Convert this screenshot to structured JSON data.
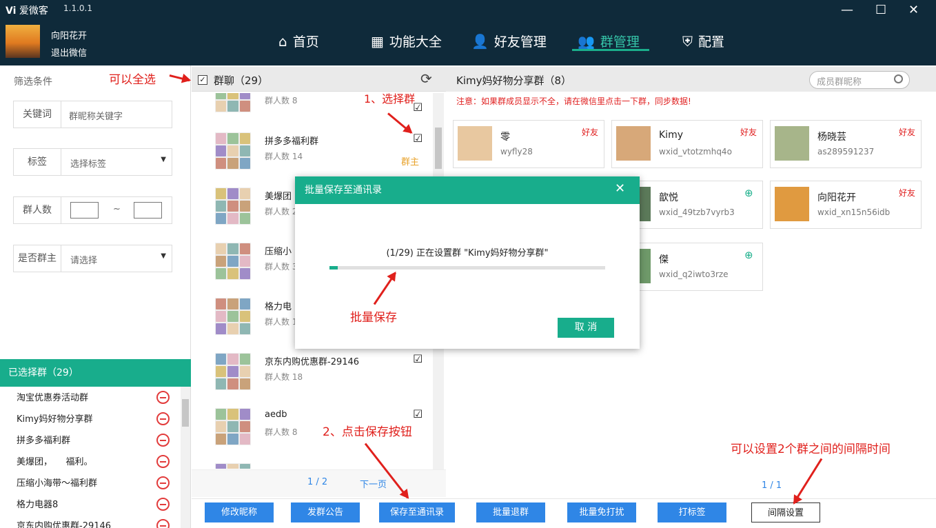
{
  "app": {
    "name": "爱微客",
    "version": "1.1.0.1",
    "logo_mark": "Vi"
  },
  "user": {
    "name": "向阳花开",
    "logout": "退出微信"
  },
  "nav": [
    {
      "label": "首页",
      "icon": "home-icon"
    },
    {
      "label": "功能大全",
      "icon": "grid-icon"
    },
    {
      "label": "好友管理",
      "icon": "user-icon"
    },
    {
      "label": "群管理",
      "icon": "group-icon"
    },
    {
      "label": "配置",
      "icon": "shield-icon"
    }
  ],
  "window": {
    "minimize": "—",
    "maximize": "☐",
    "close": "✕"
  },
  "filter": {
    "title": "筛选条件",
    "keyword_label": "关键词",
    "keyword_placeholder": "群昵称关键字",
    "tag_label": "标签",
    "tag_value": "选择标签",
    "count_label": "群人数",
    "tilde": "~",
    "owner_label": "是否群主",
    "owner_value": "请选择"
  },
  "selected": {
    "title": "已选择群（29）",
    "items": [
      "淘宝优惠券活动群",
      "Kimy妈好物分享群",
      "拼多多福利群",
      "美爆团，　　福利。",
      "压缩小海带～福利群",
      "格力电器8",
      "京东内购优惠群-29146"
    ]
  },
  "groups": {
    "header": "群聊（29）",
    "items": [
      {
        "name": "",
        "count": "群人数 8",
        "owner": "",
        "checked": "☑"
      },
      {
        "name": "拼多多福利群",
        "count": "群人数 14",
        "owner": "群主",
        "checked": "☑"
      },
      {
        "name": "美爆团",
        "count": "群人数 2",
        "owner": "",
        "checked": ""
      },
      {
        "name": "压缩小",
        "count": "群人数 3",
        "owner": "",
        "checked": ""
      },
      {
        "name": "格力电",
        "count": "群人数 1",
        "owner": "",
        "checked": ""
      },
      {
        "name": "京东内购优惠群-29146",
        "count": "群人数 18",
        "owner": "",
        "checked": "☑"
      },
      {
        "name": "aedb",
        "count": "群人数 8",
        "owner": "",
        "checked": "☑"
      },
      {
        "name": "",
        "count": "",
        "owner": "",
        "checked": ""
      }
    ],
    "page": "1 / 2",
    "next": "下一页"
  },
  "members": {
    "title": "Kimy妈好物分享群（8）",
    "search_placeholder": "成员群昵称",
    "note": "注意：如果群成员显示不全，请在微信里点击一下群，同步数据!",
    "page": "1 / 1",
    "cards": [
      {
        "name": "零",
        "id": "wyfly28",
        "badge": "好友"
      },
      {
        "name": "Kimy",
        "id": "wxid_vtotzmhq4o",
        "badge": "好友"
      },
      {
        "name": "杨晓芸",
        "id": "as289591237",
        "badge": "好友"
      },
      {
        "name": "歆悦",
        "id": "wxid_49tzb7vyrb3",
        "badge": ""
      },
      {
        "name": "向阳花开",
        "id": "wxid_xn15n56idb",
        "badge": "好友"
      },
      {
        "name": "傑",
        "id": "wxid_q2iwto3rze",
        "badge": ""
      }
    ]
  },
  "buttons": [
    "修改昵称",
    "发群公告",
    "保存至通讯录",
    "批量退群",
    "批量免打扰",
    "打标签",
    "间隔设置"
  ],
  "modal": {
    "title": "批量保存至通讯录",
    "message": "(1/29) 正在设置群 \"Kimy妈好物分享群\"",
    "cancel": "取 消",
    "progress": 0.03
  },
  "annotations": {
    "select_all": "可以全选",
    "step1": "1、选择群",
    "step2": "2、点击保存按钮",
    "batch_save": "批量保存",
    "interval": "可以设置2个群之间的间隔时间"
  },
  "colors": {
    "topbar": "#0f2a3a",
    "accent": "#18ad8c",
    "button": "#2f86e6",
    "annotation": "#e0201c"
  }
}
